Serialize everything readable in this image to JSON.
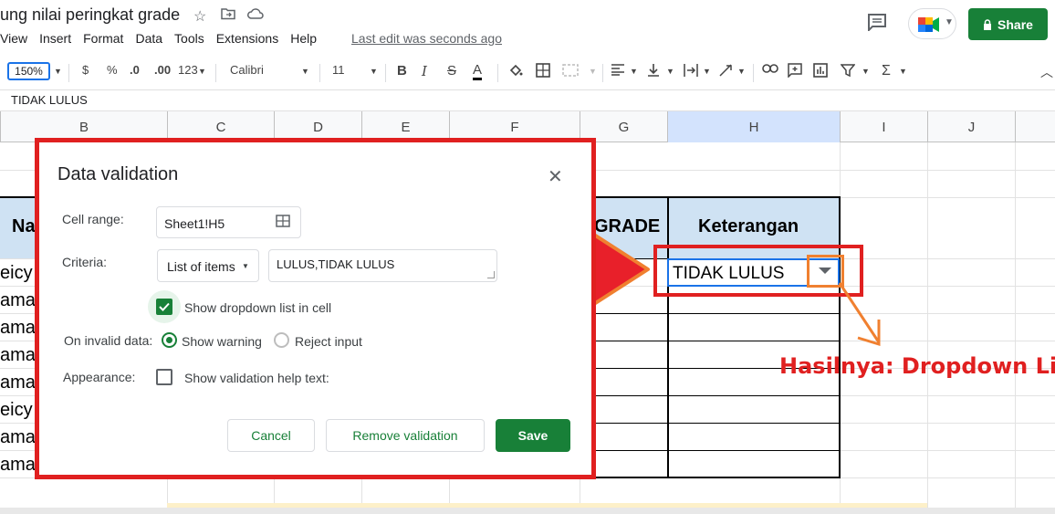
{
  "header": {
    "doc_title": "ung nilai peringkat grade",
    "menu": [
      "View",
      "Insert",
      "Format",
      "Data",
      "Tools",
      "Extensions",
      "Help"
    ],
    "last_edit": "Last edit was seconds ago",
    "share_label": "Share"
  },
  "toolbar": {
    "zoom": "150%",
    "currency": "$",
    "percent": "%",
    "dec_decrease": ".0",
    "dec_increase": ".00",
    "format_more": "123",
    "font": "Calibri",
    "font_size": "11",
    "bold": "B",
    "italic": "I",
    "strike": "S",
    "text_color": "A"
  },
  "formula_bar": {
    "value": "TIDAK LULUS"
  },
  "sheet": {
    "columns": [
      "B",
      "C",
      "D",
      "E",
      "F",
      "G",
      "H",
      "I",
      "J"
    ],
    "header_partial_left": "Na",
    "header_grade": "GRADE",
    "header_keterangan": "Keterangan",
    "row_names": [
      "eicy",
      "ama",
      "ama",
      "ama",
      "ama",
      "eicy",
      "ama",
      "ama"
    ],
    "selected_cell_value": "TIDAK LULUS"
  },
  "dialog": {
    "title": "Data validation",
    "cell_range_label": "Cell range:",
    "cell_range_value": "Sheet1!H5",
    "criteria_label": "Criteria:",
    "criteria_type": "List of items",
    "criteria_value": "LULUS,TIDAK LULUS",
    "show_dropdown_label": "Show dropdown list in cell",
    "show_dropdown_checked": true,
    "invalid_label": "On invalid data:",
    "show_warning_label": "Show warning",
    "reject_input_label": "Reject input",
    "invalid_selected": "Show warning",
    "appearance_label": "Appearance:",
    "help_text_label": "Show validation help text:",
    "cancel_label": "Cancel",
    "remove_label": "Remove validation",
    "save_label": "Save"
  },
  "annotation": {
    "text": "Hasilnya: Dropdown List"
  },
  "colors": {
    "accent_green": "#188038",
    "annotation_red": "#e02020",
    "annotation_orange": "#f08030",
    "header_blue": "#cfe2f3"
  }
}
